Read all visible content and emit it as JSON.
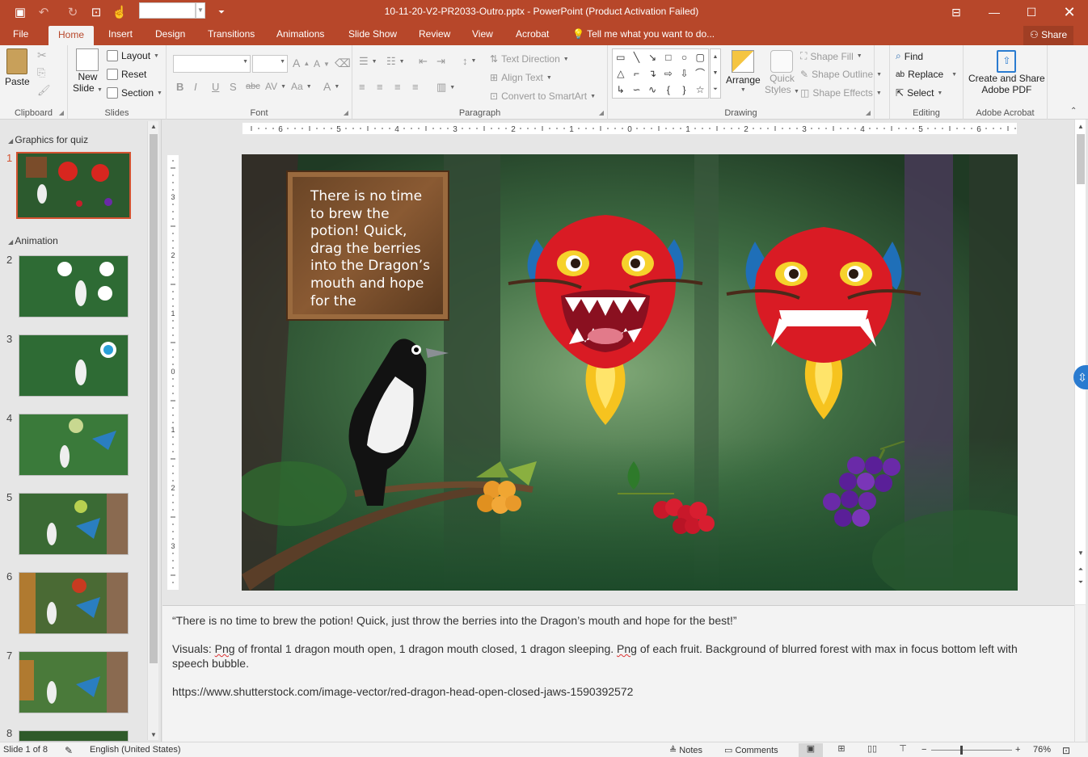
{
  "title": {
    "window_title": "10-11-20-V2-PR2033-Outro.pptx - PowerPoint (Product Activation Failed)"
  },
  "tabs": [
    "File",
    "Home",
    "Insert",
    "Design",
    "Transitions",
    "Animations",
    "Slide Show",
    "Review",
    "View",
    "Acrobat"
  ],
  "tell_me": "Tell me what you want to do...",
  "share": "Share",
  "ribbon": {
    "clipboard": {
      "paste": "Paste",
      "label": "Clipboard"
    },
    "slides": {
      "new_slide_1": "New",
      "new_slide_2": "Slide",
      "layout": "Layout",
      "reset": "Reset",
      "section": "Section",
      "label": "Slides"
    },
    "font": {
      "label": "Font",
      "bold": "B",
      "italic": "I",
      "underline": "U",
      "shadow": "S",
      "strike": "abc",
      "spacing": "AV",
      "case": "Aa",
      "color": "A",
      "grow": "A",
      "shrink": "A"
    },
    "paragraph": {
      "text_direction": "Text Direction",
      "align_text": "Align Text",
      "convert_smartart": "Convert to SmartArt",
      "label": "Paragraph"
    },
    "drawing": {
      "arrange": "Arrange",
      "quick_styles_1": "Quick",
      "quick_styles_2": "Styles",
      "shape_fill": "Shape Fill",
      "shape_outline": "Shape Outline",
      "shape_effects": "Shape Effects",
      "label": "Drawing"
    },
    "editing": {
      "find": "Find",
      "replace": "Replace",
      "select": "Select",
      "label": "Editing"
    },
    "acrobat": {
      "create_1": "Create and Share",
      "create_2": "Adobe PDF",
      "label": "Adobe Acrobat"
    }
  },
  "thumbnails": {
    "section1": "Graphics for quiz",
    "section2": "Animation",
    "nums": [
      "1",
      "2",
      "3",
      "4",
      "5",
      "6",
      "7",
      "8"
    ]
  },
  "slide": {
    "sign_text": "There is no time to brew the potion! Quick, drag the berries into the Dragon’s mouth and hope for the"
  },
  "ruler": {
    "h_labels": [
      "6",
      "5",
      "4",
      "3",
      "2",
      "1",
      "0",
      "1",
      "2",
      "3",
      "4",
      "5",
      "6"
    ],
    "v_labels": [
      "3",
      "2",
      "1",
      "0",
      "1",
      "2",
      "3"
    ]
  },
  "notes": {
    "line1": "“There is no time to brew the potion! Quick, just throw the berries into the Dragon’s mouth and hope for the best!”",
    "line2_a": "Visuals: ",
    "line2_png1": "Png",
    "line2_b": " of frontal 1 dragon mouth open, 1 dragon mouth closed, 1 dragon sleeping. ",
    "line2_png2": "Png",
    "line2_c": " of each fruit. Background of blurred forest with max in focus bottom left with speech bubble.",
    "line3": "https://www.shutterstock.com/image-vector/red-dragon-head-open-closed-jaws-1590392572"
  },
  "status": {
    "slide_of": "Slide 1 of 8",
    "language": "English (United States)",
    "notes": "Notes",
    "comments": "Comments",
    "zoom": "76%"
  }
}
